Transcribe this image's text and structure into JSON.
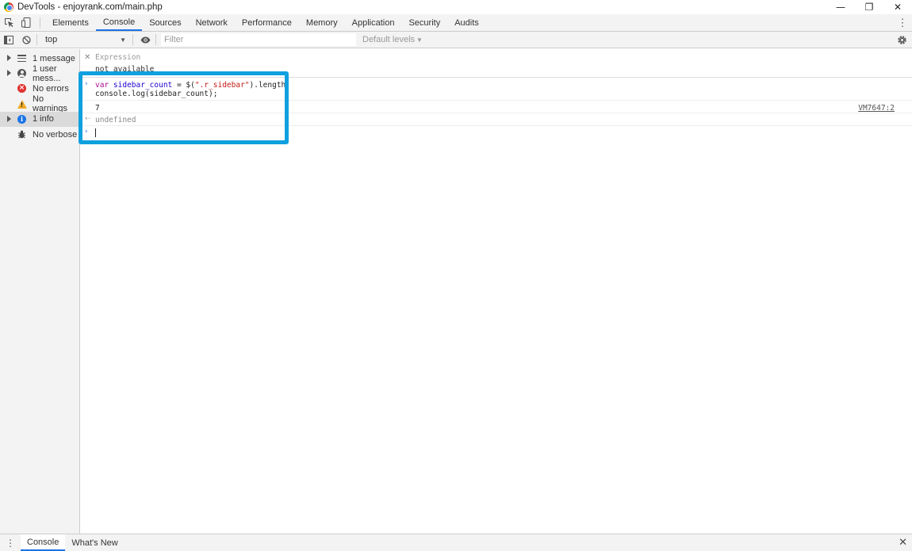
{
  "window": {
    "title": "DevTools - enjoyrank.com/main.php",
    "minimize": "—",
    "restore": "❐",
    "close": "✕"
  },
  "tabs": [
    {
      "label": "Elements"
    },
    {
      "label": "Console"
    },
    {
      "label": "Sources"
    },
    {
      "label": "Network"
    },
    {
      "label": "Performance"
    },
    {
      "label": "Memory"
    },
    {
      "label": "Application"
    },
    {
      "label": "Security"
    },
    {
      "label": "Audits"
    }
  ],
  "active_tab": "Console",
  "toolbar": {
    "context": "top",
    "filter_placeholder": "Filter",
    "levels": "Default levels"
  },
  "sidebar": {
    "items": [
      {
        "label": "1 message",
        "icon": "list-icon"
      },
      {
        "label": "1 user mess...",
        "icon": "user-icon"
      },
      {
        "label": "No errors",
        "icon": "error-icon"
      },
      {
        "label": "No warnings",
        "icon": "warning-icon"
      },
      {
        "label": "1 info",
        "icon": "info-icon"
      },
      {
        "label": "No verbose",
        "icon": "bug-icon"
      }
    ]
  },
  "console": {
    "live_expression": {
      "label": "Expression",
      "value": "not available"
    },
    "input": {
      "line1_kw": "var",
      "line1_var": "sidebar_count",
      "line1_mid": " = $(",
      "line1_str": "\".r_sidebar\"",
      "line1_end": ").length;",
      "line2": "console.log(sidebar_count);"
    },
    "log_output": "7",
    "log_source": "VM7647:2",
    "return_value": "undefined"
  },
  "drawer": {
    "tabs": [
      {
        "label": "Console"
      },
      {
        "label": "What's New"
      }
    ],
    "close": "✕"
  },
  "colors": {
    "highlight": "#0ea0df",
    "active_tab_underline": "#1a73e8"
  }
}
